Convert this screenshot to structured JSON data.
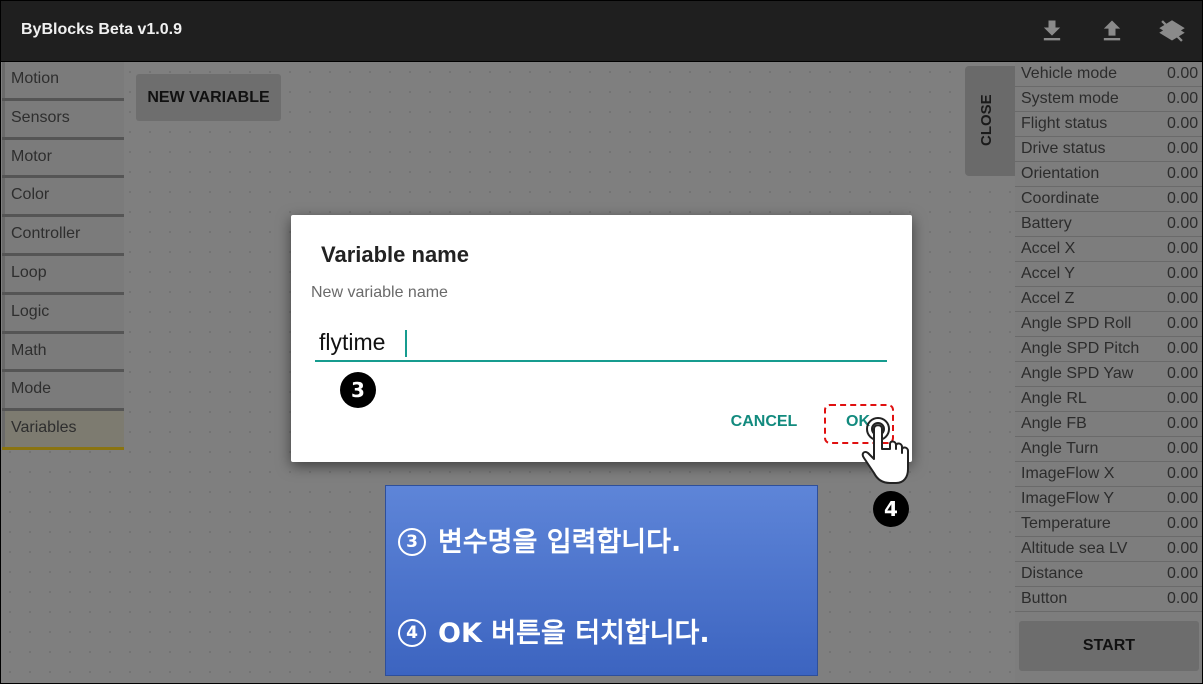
{
  "app": {
    "title": "ByBlocks Beta v1.0.9",
    "toolbar_icons": [
      "download-icon",
      "upload-icon",
      "layers-off-icon"
    ]
  },
  "categories": [
    {
      "label": "Motion"
    },
    {
      "label": "Sensors"
    },
    {
      "label": "Motor"
    },
    {
      "label": "Color"
    },
    {
      "label": "Controller"
    },
    {
      "label": "Loop"
    },
    {
      "label": "Logic"
    },
    {
      "label": "Math"
    },
    {
      "label": "Mode"
    },
    {
      "label": "Variables",
      "active": true
    }
  ],
  "workspace": {
    "new_variable_label": "NEW VARIABLE",
    "close_label": "CLOSE"
  },
  "telemetry": {
    "rows": [
      {
        "name": "Vehicle mode",
        "value": "0.00"
      },
      {
        "name": "System mode",
        "value": "0.00"
      },
      {
        "name": "Flight status",
        "value": "0.00"
      },
      {
        "name": "Drive status",
        "value": "0.00"
      },
      {
        "name": "Orientation",
        "value": "0.00"
      },
      {
        "name": "Coordinate",
        "value": "0.00"
      },
      {
        "name": "Battery",
        "value": "0.00"
      },
      {
        "name": "Accel X",
        "value": "0.00"
      },
      {
        "name": "Accel Y",
        "value": "0.00"
      },
      {
        "name": "Accel Z",
        "value": "0.00"
      },
      {
        "name": "Angle SPD Roll",
        "value": "0.00"
      },
      {
        "name": "Angle SPD Pitch",
        "value": "0.00"
      },
      {
        "name": "Angle SPD Yaw",
        "value": "0.00"
      },
      {
        "name": "Angle RL",
        "value": "0.00"
      },
      {
        "name": "Angle FB",
        "value": "0.00"
      },
      {
        "name": "Angle Turn",
        "value": "0.00"
      },
      {
        "name": "ImageFlow X",
        "value": "0.00"
      },
      {
        "name": "ImageFlow Y",
        "value": "0.00"
      },
      {
        "name": "Temperature",
        "value": "0.00"
      },
      {
        "name": "Altitude sea LV",
        "value": "0.00"
      },
      {
        "name": "Distance",
        "value": "0.00"
      },
      {
        "name": "Button",
        "value": "0.00"
      }
    ],
    "start_label": "START"
  },
  "dialog": {
    "title": "Variable name",
    "label": "New variable name",
    "input_value": "flytime",
    "cancel_label": "CANCEL",
    "ok_label": "OK"
  },
  "annotations": {
    "step3_marker": "3",
    "step4_marker": "4",
    "instructions": [
      {
        "num": "3",
        "text": "변수명을 입력합니다."
      },
      {
        "num": "4",
        "text": "OK 버튼을 터치합니다."
      }
    ]
  },
  "colors": {
    "accent": "#128a7e",
    "highlight": "#e01010",
    "instruction_bg": "#4a72cc"
  }
}
